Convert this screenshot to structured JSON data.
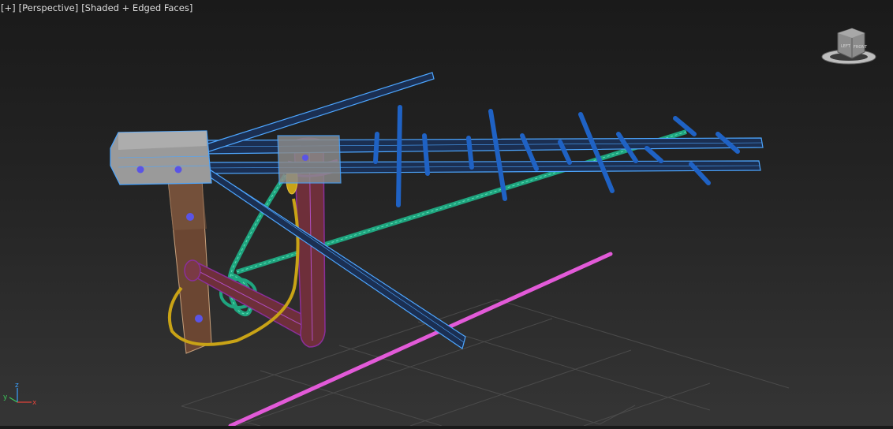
{
  "viewport": {
    "labels": [
      "[+]",
      "[Perspective]",
      "[Shaded + Edged Faces]"
    ],
    "view_name": "Perspective",
    "shading_mode": "Shaded + Edged Faces"
  },
  "viewcube": {
    "face_label": "FRONT",
    "side_label": "LEFT"
  },
  "axis_tripod": {
    "x": "x",
    "y": "y",
    "z": "z"
  },
  "colors": {
    "background_top": "#1a1a1a",
    "background_bottom": "#353535",
    "grid": "#4a4a4a",
    "antenna_wireframe": "#4da6ff",
    "antenna_elements": "#1f62c4",
    "pole": "#6e2f3a",
    "pole_wire": "#8a2f9a",
    "bracket_plate": "#6b4632",
    "green_cable": "#1fa57f",
    "yellow_cable": "#c9a316",
    "pink_line": "#e25ad8",
    "mount_metal": "#9a9a9a"
  }
}
